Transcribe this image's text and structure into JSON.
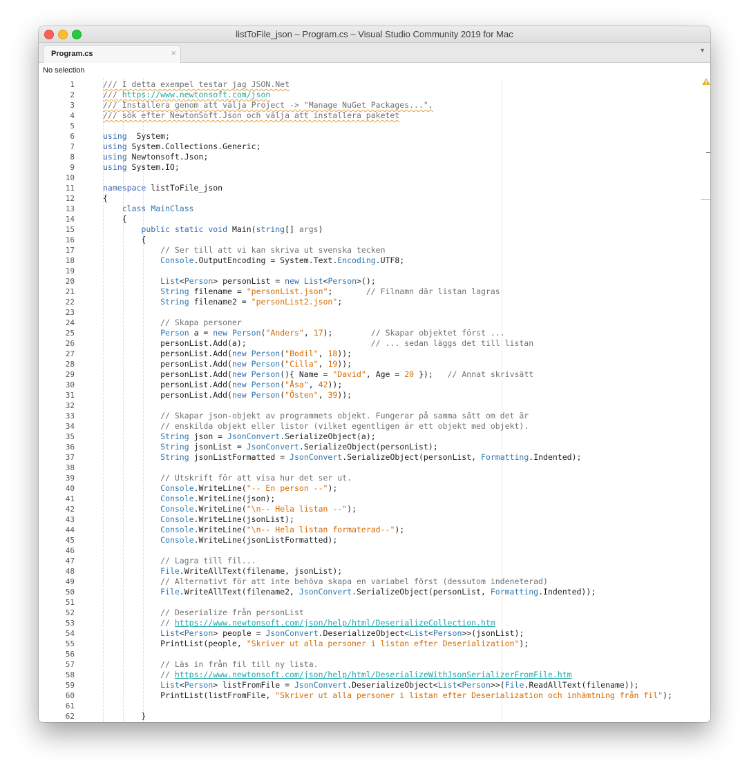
{
  "window": {
    "title": "listToFile_json – Program.cs – Visual Studio Community 2019 for Mac"
  },
  "tab": {
    "label": "Program.cs",
    "close": "×",
    "menu": "▾"
  },
  "navbar": {
    "selection": "No selection"
  },
  "colors": {
    "keyword": "#3b68b0",
    "type": "#2f78b0",
    "comment": "#707070",
    "string": "#d66a00",
    "url": "#1fa6a6",
    "warning": "#e8a03a"
  },
  "icons": {
    "warning": "warning-triangle-icon"
  },
  "lines": [
    [
      [
        "cm squig",
        "/// I detta exempel testar jag JSON.Net"
      ]
    ],
    [
      [
        "cm squig",
        "/// "
      ],
      [
        "url squig",
        "https://www.newtonsoft.com/json"
      ]
    ],
    [
      [
        "cm squig",
        "/// Installera genom att välja Project -> \"Manage NuGet Packages...\","
      ]
    ],
    [
      [
        "cm squig",
        "/// sök efter NewtonSoft.Json och välja att installera paketet"
      ]
    ],
    [],
    [
      [
        "kw",
        "using"
      ],
      [
        "",
        "  System;"
      ]
    ],
    [
      [
        "kw",
        "using"
      ],
      [
        "",
        " System.Collections.Generic;"
      ]
    ],
    [
      [
        "kw",
        "using"
      ],
      [
        "",
        " Newtonsoft.Json;"
      ]
    ],
    [
      [
        "kw",
        "using"
      ],
      [
        "",
        " System.IO;"
      ]
    ],
    [],
    [
      [
        "kw",
        "namespace"
      ],
      [
        "",
        " listToFile_json"
      ]
    ],
    [
      [
        "",
        "{"
      ]
    ],
    [
      [
        "",
        "    "
      ],
      [
        "kw",
        "class"
      ],
      [
        "",
        " "
      ],
      [
        "ty",
        "MainClass"
      ]
    ],
    [
      [
        "",
        "    {"
      ]
    ],
    [
      [
        "",
        "        "
      ],
      [
        "kw",
        "public static void"
      ],
      [
        "",
        " Main("
      ],
      [
        "kw",
        "string"
      ],
      [
        "",
        "[] "
      ],
      [
        "cm",
        "args"
      ],
      [
        "",
        ")"
      ]
    ],
    [
      [
        "",
        "        {"
      ]
    ],
    [
      [
        "",
        "            "
      ],
      [
        "cm",
        "// Ser till att vi kan skriva ut svenska tecken"
      ]
    ],
    [
      [
        "",
        "            "
      ],
      [
        "ty",
        "Console"
      ],
      [
        "",
        ".OutputEncoding = System.Text."
      ],
      [
        "ty",
        "Encoding"
      ],
      [
        "",
        ".UTF8;"
      ]
    ],
    [],
    [
      [
        "",
        "            "
      ],
      [
        "ty",
        "List"
      ],
      [
        "",
        "<"
      ],
      [
        "ty",
        "Person"
      ],
      [
        "",
        "> personList = "
      ],
      [
        "kw",
        "new"
      ],
      [
        "",
        " "
      ],
      [
        "ty",
        "List"
      ],
      [
        "",
        "<"
      ],
      [
        "ty",
        "Person"
      ],
      [
        "",
        ">();"
      ]
    ],
    [
      [
        "",
        "            "
      ],
      [
        "ty",
        "String"
      ],
      [
        "",
        " filename = "
      ],
      [
        "st",
        "\"personList.json\""
      ],
      [
        "",
        ";       "
      ],
      [
        "cm",
        "// Filnamn där listan lagras"
      ]
    ],
    [
      [
        "",
        "            "
      ],
      [
        "ty",
        "String"
      ],
      [
        "",
        " filename2 = "
      ],
      [
        "st",
        "\"personList2.json\""
      ],
      [
        "",
        ";"
      ]
    ],
    [],
    [
      [
        "",
        "            "
      ],
      [
        "cm",
        "// Skapa personer"
      ]
    ],
    [
      [
        "",
        "            "
      ],
      [
        "ty",
        "Person"
      ],
      [
        "",
        " a = "
      ],
      [
        "kw",
        "new"
      ],
      [
        "",
        " "
      ],
      [
        "ty",
        "Person"
      ],
      [
        "",
        "("
      ],
      [
        "st",
        "\"Anders\""
      ],
      [
        "",
        ", "
      ],
      [
        "nm",
        "17"
      ],
      [
        "",
        ");        "
      ],
      [
        "cm",
        "// Skapar objektet först ..."
      ]
    ],
    [
      [
        "",
        "            personList.Add(a);                          "
      ],
      [
        "cm",
        "// ... sedan läggs det till listan"
      ]
    ],
    [
      [
        "",
        "            personList.Add("
      ],
      [
        "kw",
        "new"
      ],
      [
        "",
        " "
      ],
      [
        "ty",
        "Person"
      ],
      [
        "",
        "("
      ],
      [
        "st",
        "\"Bodil\""
      ],
      [
        "",
        ", "
      ],
      [
        "nm",
        "18"
      ],
      [
        "",
        "));"
      ]
    ],
    [
      [
        "",
        "            personList.Add("
      ],
      [
        "kw",
        "new"
      ],
      [
        "",
        " "
      ],
      [
        "ty",
        "Person"
      ],
      [
        "",
        "("
      ],
      [
        "st",
        "\"Cilla\""
      ],
      [
        "",
        ", "
      ],
      [
        "nm",
        "19"
      ],
      [
        "",
        "));"
      ]
    ],
    [
      [
        "",
        "            personList.Add("
      ],
      [
        "kw",
        "new"
      ],
      [
        "",
        " "
      ],
      [
        "ty",
        "Person"
      ],
      [
        "",
        "(){ Name = "
      ],
      [
        "st",
        "\"David\""
      ],
      [
        "",
        ", Age = "
      ],
      [
        "nm",
        "20"
      ],
      [
        "",
        " });   "
      ],
      [
        "cm",
        "// Annat skrivsätt"
      ]
    ],
    [
      [
        "",
        "            personList.Add("
      ],
      [
        "kw",
        "new"
      ],
      [
        "",
        " "
      ],
      [
        "ty",
        "Person"
      ],
      [
        "",
        "("
      ],
      [
        "st",
        "\"Åsa\""
      ],
      [
        "",
        ", "
      ],
      [
        "nm",
        "42"
      ],
      [
        "",
        "));"
      ]
    ],
    [
      [
        "",
        "            personList.Add("
      ],
      [
        "kw",
        "new"
      ],
      [
        "",
        " "
      ],
      [
        "ty",
        "Person"
      ],
      [
        "",
        "("
      ],
      [
        "st",
        "\"Östen\""
      ],
      [
        "",
        ", "
      ],
      [
        "nm",
        "39"
      ],
      [
        "",
        "));"
      ]
    ],
    [],
    [
      [
        "",
        "            "
      ],
      [
        "cm",
        "// Skapar json-objekt av programmets objekt. Fungerar på samma sätt om det är"
      ]
    ],
    [
      [
        "",
        "            "
      ],
      [
        "cm",
        "// enskilda objekt eller listor (vilket egentligen är ett objekt med objekt)."
      ]
    ],
    [
      [
        "",
        "            "
      ],
      [
        "ty",
        "String"
      ],
      [
        "",
        " json = "
      ],
      [
        "ty",
        "JsonConvert"
      ],
      [
        "",
        ".SerializeObject(a);"
      ]
    ],
    [
      [
        "",
        "            "
      ],
      [
        "ty",
        "String"
      ],
      [
        "",
        " jsonList = "
      ],
      [
        "ty",
        "JsonConvert"
      ],
      [
        "",
        ".SerializeObject(personList);"
      ]
    ],
    [
      [
        "",
        "            "
      ],
      [
        "ty",
        "String"
      ],
      [
        "",
        " jsonListFormatted = "
      ],
      [
        "ty",
        "JsonConvert"
      ],
      [
        "",
        ".SerializeObject(personList, "
      ],
      [
        "ty",
        "Formatting"
      ],
      [
        "",
        ".Indented);"
      ]
    ],
    [],
    [
      [
        "",
        "            "
      ],
      [
        "cm",
        "// Utskrift för att visa hur det ser ut."
      ]
    ],
    [
      [
        "",
        "            "
      ],
      [
        "ty",
        "Console"
      ],
      [
        "",
        ".WriteLine("
      ],
      [
        "st",
        "\"-- En person --\""
      ],
      [
        "",
        ");"
      ]
    ],
    [
      [
        "",
        "            "
      ],
      [
        "ty",
        "Console"
      ],
      [
        "",
        ".WriteLine(json);"
      ]
    ],
    [
      [
        "",
        "            "
      ],
      [
        "ty",
        "Console"
      ],
      [
        "",
        ".WriteLine("
      ],
      [
        "st",
        "\"\\n-- Hela listan --\""
      ],
      [
        "",
        ");"
      ]
    ],
    [
      [
        "",
        "            "
      ],
      [
        "ty",
        "Console"
      ],
      [
        "",
        ".WriteLine(jsonList);"
      ]
    ],
    [
      [
        "",
        "            "
      ],
      [
        "ty",
        "Console"
      ],
      [
        "",
        ".WriteLine("
      ],
      [
        "st",
        "\"\\n-- Hela listan formaterad--\""
      ],
      [
        "",
        ");"
      ]
    ],
    [
      [
        "",
        "            "
      ],
      [
        "ty",
        "Console"
      ],
      [
        "",
        ".WriteLine(jsonListFormatted);"
      ]
    ],
    [],
    [
      [
        "",
        "            "
      ],
      [
        "cm",
        "// Lagra till fil..."
      ]
    ],
    [
      [
        "",
        "            "
      ],
      [
        "ty",
        "File"
      ],
      [
        "",
        ".WriteAllText(filename, jsonList);"
      ]
    ],
    [
      [
        "",
        "            "
      ],
      [
        "cm",
        "// Alternativt för att inte behöva skapa en variabel först (dessutom indeneterad)"
      ]
    ],
    [
      [
        "",
        "            "
      ],
      [
        "ty",
        "File"
      ],
      [
        "",
        ".WriteAllText(filename2, "
      ],
      [
        "ty",
        "JsonConvert"
      ],
      [
        "",
        ".SerializeObject(personList, "
      ],
      [
        "ty",
        "Formatting"
      ],
      [
        "",
        ".Indented));"
      ]
    ],
    [],
    [
      [
        "",
        "            "
      ],
      [
        "cm",
        "// Deserialize från personList"
      ]
    ],
    [
      [
        "",
        "            "
      ],
      [
        "cm",
        "// "
      ],
      [
        "url",
        "https://www.newtonsoft.com/json/help/html/DeserializeCollection.htm"
      ]
    ],
    [
      [
        "",
        "            "
      ],
      [
        "ty",
        "List"
      ],
      [
        "",
        "<"
      ],
      [
        "ty",
        "Person"
      ],
      [
        "",
        "> people = "
      ],
      [
        "ty",
        "JsonConvert"
      ],
      [
        "",
        ".DeserializeObject<"
      ],
      [
        "ty",
        "List"
      ],
      [
        "",
        "<"
      ],
      [
        "ty",
        "Person"
      ],
      [
        "",
        ">>(jsonList);"
      ]
    ],
    [
      [
        "",
        "            PrintList(people, "
      ],
      [
        "st",
        "\"Skriver ut alla personer i listan efter Deserialization\""
      ],
      [
        "",
        ");"
      ]
    ],
    [],
    [
      [
        "",
        "            "
      ],
      [
        "cm",
        "// Läs in från fil till ny lista."
      ]
    ],
    [
      [
        "",
        "            "
      ],
      [
        "cm",
        "// "
      ],
      [
        "url",
        "https://www.newtonsoft.com/json/help/html/DeserializeWithJsonSerializerFromFile.htm"
      ]
    ],
    [
      [
        "",
        "            "
      ],
      [
        "ty",
        "List"
      ],
      [
        "",
        "<"
      ],
      [
        "ty",
        "Person"
      ],
      [
        "",
        "> listFromFile = "
      ],
      [
        "ty",
        "JsonConvert"
      ],
      [
        "",
        ".DeserializeObject<"
      ],
      [
        "ty",
        "List"
      ],
      [
        "",
        "<"
      ],
      [
        "ty",
        "Person"
      ],
      [
        "",
        ">>("
      ],
      [
        "ty",
        "File"
      ],
      [
        "",
        ".ReadAllText(filename));"
      ]
    ],
    [
      [
        "",
        "            PrintList(listFromFile, "
      ],
      [
        "st",
        "\"Skriver ut alla personer i listan efter Deserialization och inhämtning från fil\""
      ],
      [
        "",
        ");"
      ]
    ],
    [],
    [
      [
        "",
        "        }"
      ]
    ]
  ]
}
